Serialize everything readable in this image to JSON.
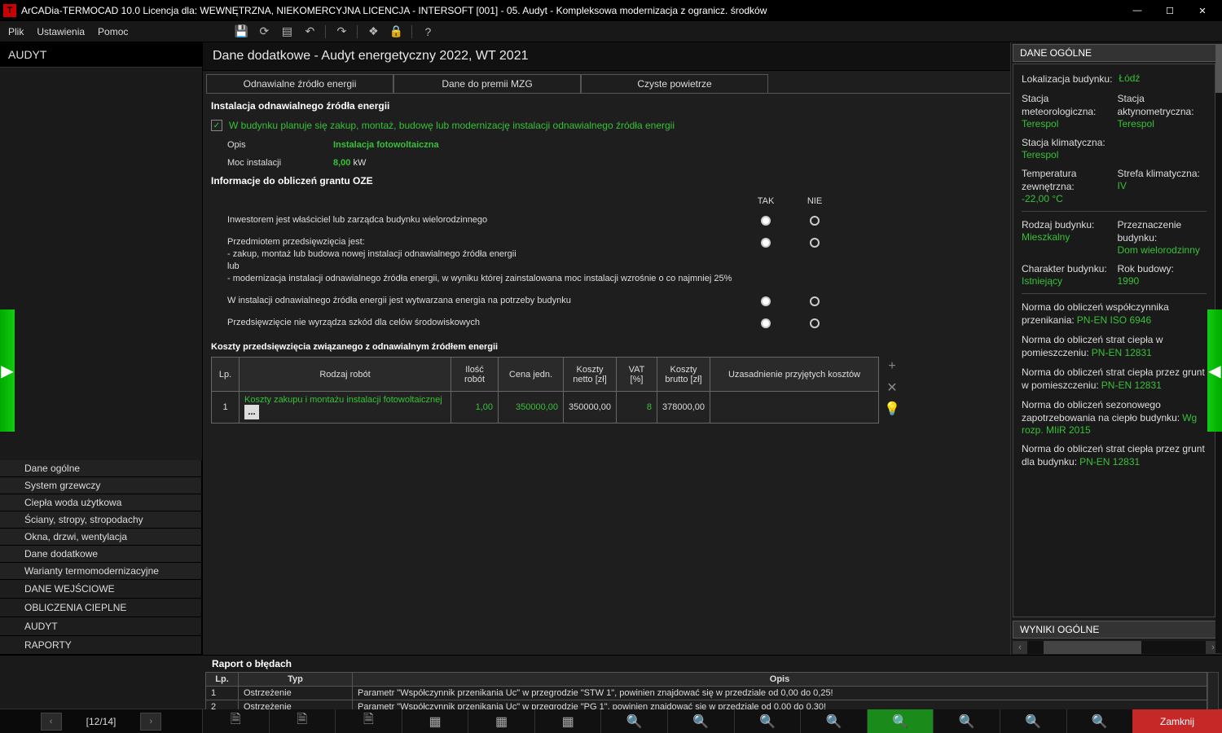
{
  "window": {
    "title": "ArCADia-TERMOCAD 10.0 Licencja dla: WEWNĘTRZNA, NIEKOMERCYJNA LICENCJA - INTERSOFT [001] - 05. Audyt - Kompleksowa modernizacja z ogranicz. środków"
  },
  "menu": {
    "file": "Plik",
    "settings": "Ustawienia",
    "help": "Pomoc"
  },
  "left": {
    "header": "AUDYT",
    "items": [
      "Dane ogólne",
      "System grzewczy",
      "Ciepła woda użytkowa",
      "Ściany, stropy, stropodachy",
      "Okna, drzwi, wentylacja",
      "Dane dodatkowe",
      "Warianty termomodernizacyjne"
    ],
    "sections": [
      "DANE WEJŚCIOWE",
      "OBLICZENIA CIEPLNE",
      "AUDYT",
      "RAPORTY"
    ]
  },
  "page": {
    "title": "Dane dodatkowe - Audyt energetyczny 2022, WT 2021",
    "tabs": [
      "Odnawialne źródło energii",
      "Dane do premii MZG",
      "Czyste powietrze"
    ],
    "section1": "Instalacja odnawialnego źródła energii",
    "checkbox": "W budynku planuje się zakup, montaż, budowę lub modernizację instalacji odnawialnego źródła energii",
    "opis_label": "Opis",
    "opis_val": "Instalacja fotowoltaiczna",
    "moc_label": "Moc instalacji",
    "moc_val": "8,00",
    "moc_unit": " kW",
    "section2": "Informacje do obliczeń grantu OZE",
    "tak": "TAK",
    "nie": "NIE",
    "q1": "Inwestorem jest właściciel lub zarządca budynku wielorodzinnego",
    "q2": "Przedmiotem przedsięwzięcia jest:\n - zakup, montaż lub budowa nowej instalacji odnawialnego źródła energii\n    lub\n - modernizacja instalacji odnawialnego źródła energii, w wyniku której zainstalowana moc instalacji wzrośnie o co najmniej 25%",
    "q3": "W instalacji odnawialnego źródła energii jest wytwarzana energia na potrzeby budynku",
    "q4": "Przedsięwzięcie nie wyrządza szkód dla celów środowiskowych",
    "costs_title": "Koszty przedsięwzięcia związanego z odnawialnym źródłem energii",
    "th": {
      "lp": "Lp.",
      "rodzaj": "Rodzaj robót",
      "ilosc": "Ilość robót",
      "cena": "Cena jedn.",
      "netto": "Koszty netto [zł]",
      "vat": "VAT [%]",
      "brutto": "Koszty brutto [zł]",
      "uzas": "Uzasadnienie przyjętych kosztów"
    },
    "row": {
      "lp": "1",
      "rodzaj": "Koszty zakupu i montażu instalacji fotowoltaicznej",
      "ilosc": "1,00",
      "cena": "350000,00",
      "netto": "350000,00",
      "vat": "8",
      "brutto": "378000,00",
      "uzas": ""
    }
  },
  "right": {
    "header1": "DANE OGÓLNE",
    "lok_l": "Lokalizacja budynku:",
    "lok_v": "Łódź",
    "sm_l": "Stacja meteorologiczna:",
    "sm_v": "Terespol",
    "sa_l": "Stacja aktynometryczna:",
    "sa_v": "Terespol",
    "sk_l": "Stacja klimatyczna:",
    "sk_v": "Terespol",
    "tz_l": "Temperatura zewnętrzna:",
    "tz_v": "-22,00 °C",
    "strk_l": "Strefa klimatyczna:",
    "strk_v": "IV",
    "rb_l": "Rodzaj budynku:",
    "rb_v": "Mieszkalny",
    "pb_l": "Przeznaczenie budynku:",
    "pb_v": "Dom wielorodzinny",
    "chb_l": "Charakter budynku:",
    "chb_v": "Istniejący",
    "rok_l": "Rok budowy:",
    "rok_v": "1990",
    "n1_l": "Norma do obliczeń współczynnika przenikania:",
    "n1_v": "PN-EN ISO 6946",
    "n2_l": "Norma do obliczeń strat ciepła w pomieszczeniu:",
    "n2_v": "PN-EN 12831",
    "n3_l": "Norma do obliczeń strat ciepła przez grunt w pomieszczeniu:",
    "n3_v": "PN-EN 12831",
    "n4_l": "Norma do obliczeń sezonowego zapotrzebowania na ciepło budynku:",
    "n4_v": "Wg rozp. MIiR 2015",
    "n5_l": "Norma do obliczeń strat ciepła przez grunt dla budynku:",
    "n5_v": "PN-EN 12831",
    "header2": "WYNIKI OGÓLNE"
  },
  "errors": {
    "title": "Raport o błędach",
    "th": {
      "lp": "Lp.",
      "typ": "Typ",
      "opis": "Opis"
    },
    "rows": [
      {
        "lp": "1",
        "typ": "Ostrzeżenie",
        "opis": "Parametr \"Współczynnik przenikania Uc\" w przegrodzie \"STW 1\", powinien znajdować się w przedziale od 0,00 do 0,25!"
      },
      {
        "lp": "2",
        "typ": "Ostrzeżenie",
        "opis": "Parametr \"Współczynnik przenikania Uc\" w przegrodzie \"PG 1\", powinien znajdować się w przedziale od 0,00 do 0,30!"
      }
    ]
  },
  "footer": {
    "page": "[12/14]",
    "close": "Zamknij"
  }
}
